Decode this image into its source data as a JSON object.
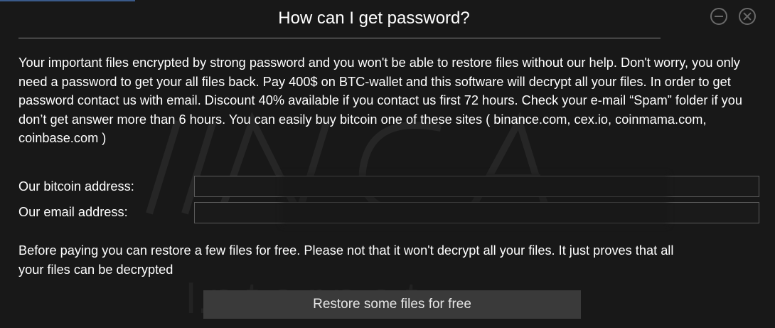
{
  "window": {
    "title": "How can I get password?"
  },
  "message": {
    "body": "Your important files encrypted by strong password and you won't be able to restore files without our help. Don't worry, you only need a password to get your all files back. Pay 400$ on BTC-wallet and this software will decrypt all your files. In order to get password contact us with email. Discount 40% available if you contact us first 72 hours. Check your e-mail “Spam” folder if you don’t get answer more than 6 hours. You can easily buy bitcoin one of these sites ( binance.com, cex.io, coinmama.com, coinbase.com )"
  },
  "addresses": {
    "bitcoin_label": "Our bitcoin address:",
    "bitcoin_value": "",
    "email_label": "Our email address:",
    "email_value": ""
  },
  "free_restore": {
    "note": "Before paying you can restore a few files for free. Please not that it won't decrypt all your files. It just proves that all your files can be decrypted",
    "button_label": "Restore some files for free"
  },
  "icons": {
    "minimize": "minimize-circle-icon",
    "close": "close-circle-icon"
  },
  "colors": {
    "background": "#181818",
    "text": "#ffffff",
    "button": "#3a3a3a",
    "border": "#5a5a5a",
    "accent": "#3a5a8a"
  }
}
